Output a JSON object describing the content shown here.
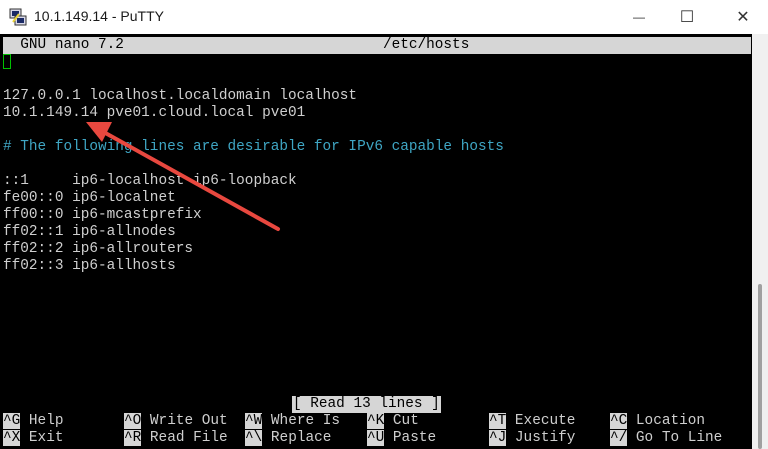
{
  "window": {
    "title": "10.1.149.14 - PuTTY",
    "icon": "putty-icon",
    "controls": {
      "minimize": "—",
      "maximize": "☐",
      "close": "✕"
    }
  },
  "nano": {
    "header": "  GNU nano 7.2                              /etc/hosts",
    "lines": [
      "",
      "",
      "127.0.0.1 localhost.localdomain localhost",
      "10.1.149.14 pve01.cloud.local pve01",
      "",
      "# The following lines are desirable for IPv6 capable hosts",
      "",
      "::1     ip6-localhost ip6-loopback",
      "fe00::0 ip6-localnet",
      "ff00::0 ip6-mcastprefix",
      "ff02::1 ip6-allnodes",
      "ff02::2 ip6-allrouters",
      "ff02::3 ip6-allhosts"
    ],
    "status": "[ Read 13 lines ]",
    "shortcuts_row1": [
      {
        "key": "^G",
        "label": " Help"
      },
      {
        "key": "^O",
        "label": " Write Out"
      },
      {
        "key": "^W",
        "label": " Where Is"
      },
      {
        "key": "^K",
        "label": " Cut"
      },
      {
        "key": "^T",
        "label": " Execute"
      },
      {
        "key": "^C",
        "label": " Location"
      }
    ],
    "shortcuts_row2": [
      {
        "key": "^X",
        "label": " Exit"
      },
      {
        "key": "^R",
        "label": " Read File"
      },
      {
        "key": "^\\",
        "label": " Replace"
      },
      {
        "key": "^U",
        "label": " Paste"
      },
      {
        "key": "^J",
        "label": " Justify"
      },
      {
        "key": "^/",
        "label": " Go To Line"
      }
    ]
  },
  "colors": {
    "terminal_bg": "#000000",
    "text": "#cfcfcf",
    "comment": "#3fa6c4",
    "arrow": "#e8483f",
    "cursor": "#00c000"
  }
}
